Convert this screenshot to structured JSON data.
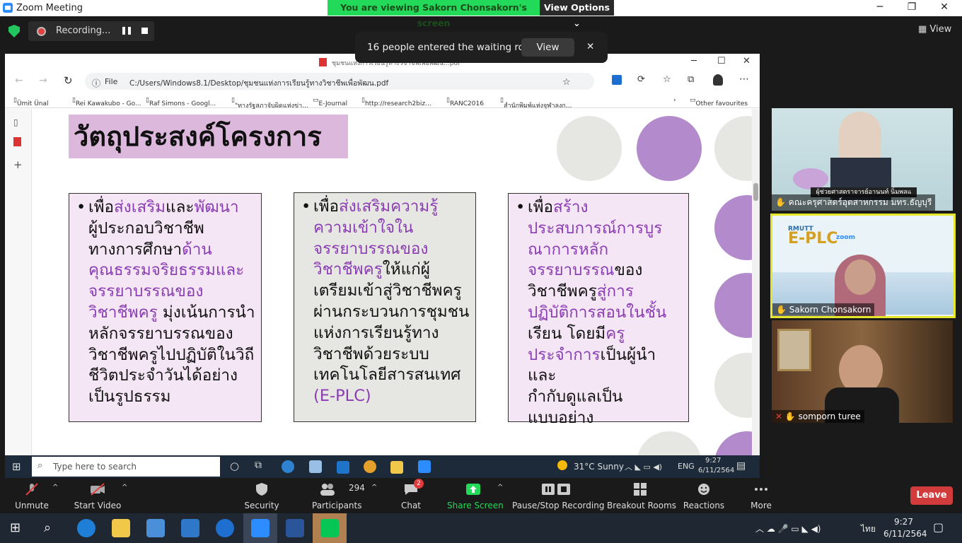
{
  "window": {
    "title": "Zoom Meeting"
  },
  "banner": {
    "text": "You are viewing Sakorn  Chonsakorn's screen",
    "view_options": "View Options"
  },
  "recording": {
    "label": "Recording..."
  },
  "top_view": {
    "label": "View"
  },
  "notification": {
    "text": "16 people entered the waiting room",
    "view": "View",
    "close": "✕"
  },
  "browser": {
    "title": "ชุมชนแห่งการเรียนรู้ทางวิชาชีพเพื่อพัฒน...pdf",
    "file_label": "File",
    "url": "C:/Users/Windows8.1/Desktop/ชุมชนแห่งการเรียนรู้ทางวิชาชีพเพื่อพัฒน.pdf",
    "bookmarks": [
      "Ümit Ünal",
      "Rei Kawakubo - Go...",
      "Raf Simons - Googl...",
      "\"ทางรัฐสภาจับผิดแห่งข่า...",
      "E-Journal",
      "http://research2biz...",
      "RANC2016",
      "สำนักพิมพ์แห่งจุฬาลงก..."
    ],
    "other_favourites": "Other favourites"
  },
  "slide": {
    "heading": "วัตถุประสงค์โครงการ",
    "boxes": [
      {
        "lines": [
          [
            [
              "เพื่อ",
              ""
            ],
            [
              "ส่งเสริม",
              "pu"
            ],
            [
              "และ",
              ""
            ],
            [
              "พัฒนา",
              "pu"
            ]
          ],
          [
            [
              "ผู้ประกอบวิชาชีพ",
              ""
            ]
          ],
          [
            [
              "ทางการศึกษา",
              ""
            ],
            [
              "ด้าน",
              "pu"
            ]
          ],
          [
            [
              "คุณธรรมจริยธรรมและ",
              "pu"
            ]
          ],
          [
            [
              "จรรยาบรรณของ",
              "pu"
            ]
          ],
          [
            [
              "วิชาชีพครู",
              "pu"
            ],
            [
              " มุ่งเน้นการนำ",
              ""
            ]
          ],
          [
            [
              "หลักจรรยาบรรณของ",
              ""
            ]
          ],
          [
            [
              "วิชาชีพครูไปปฏิบัติในวิถี",
              ""
            ]
          ],
          [
            [
              "ชีวิตประจำวันได้อย่าง",
              ""
            ]
          ],
          [
            [
              "เป็นรูปธรรม",
              ""
            ]
          ]
        ]
      },
      {
        "lines": [
          [
            [
              "เพื่อ",
              ""
            ],
            [
              "ส่งเสริมความรู้",
              "pu"
            ]
          ],
          [
            [
              "ความเข้าใจใน",
              "pu"
            ]
          ],
          [
            [
              "จรรยาบรรณของ",
              "pu"
            ]
          ],
          [
            [
              "วิชาชีพครู",
              "pu"
            ],
            [
              "ให้แก่ผู้",
              ""
            ]
          ],
          [
            [
              "เตรียมเข้าสู่วิชาชีพครู",
              ""
            ]
          ],
          [
            [
              "ผ่านกระบวนการชุมชน",
              ""
            ]
          ],
          [
            [
              "แห่งการเรียนรู้ทาง",
              ""
            ]
          ],
          [
            [
              "วิชาชีพด้วยระบบ",
              ""
            ]
          ],
          [
            [
              "เทคโนโลยีสารสนเทศ",
              ""
            ]
          ],
          [
            [
              "(E-PLC)",
              "pu"
            ]
          ]
        ]
      },
      {
        "lines": [
          [
            [
              "เพื่อ",
              ""
            ],
            [
              "สร้าง",
              "pu"
            ]
          ],
          [
            [
              "ประสบการณ์การบูร",
              "pu"
            ]
          ],
          [
            [
              "ณาการหลัก",
              "pu"
            ]
          ],
          [
            [
              "จรรยาบรรณ",
              "pu"
            ],
            [
              "ของ",
              ""
            ]
          ],
          [
            [
              "วิชาชีพครู",
              ""
            ],
            [
              "สู่การ",
              "pu"
            ]
          ],
          [
            [
              "ปฏิบัติการสอนในชั้น",
              "pu"
            ]
          ],
          [
            [
              "เรียน",
              ""
            ],
            [
              " โดยมี",
              ""
            ],
            [
              "ครู",
              "pu"
            ]
          ],
          [
            [
              "ประจำการ",
              "pu"
            ],
            [
              "เป็นผู้นำและ",
              ""
            ]
          ],
          [
            [
              "กำกับดูแลเป็น",
              ""
            ]
          ],
          [
            [
              "แบบอย่าง",
              ""
            ]
          ]
        ]
      }
    ]
  },
  "taskbar_inner": {
    "search": "Type here to search",
    "weather": "31°C  Sunny",
    "lang": "ENG",
    "time": "9:27",
    "date": "6/11/2564"
  },
  "videos": [
    {
      "name": "คณะครุศาสตร์อุตสาหกรรม มทร.ธัญบุรี",
      "caption": "ผู้ช่วยศาสตราจารย์อานนท์ นิ่มพลแ"
    },
    {
      "name": "Sakorn  Chonsakorn",
      "logo": "E-PLC",
      "logo_small": "RMUTT",
      "logo_zoom": "zoom"
    },
    {
      "name": "somporn turee"
    }
  ],
  "toolbar": {
    "items": [
      "Unmute",
      "Start Video",
      "Security",
      "Participants",
      "Chat",
      "Share Screen",
      "Pause/Stop Recording",
      "Breakout Rooms",
      "Reactions",
      "More"
    ],
    "participants_count": "294",
    "chat_badge": "2",
    "leave": "Leave"
  },
  "taskbar_outer": {
    "lang": "ไทย",
    "time": "9:27",
    "date": "6/11/2564"
  }
}
